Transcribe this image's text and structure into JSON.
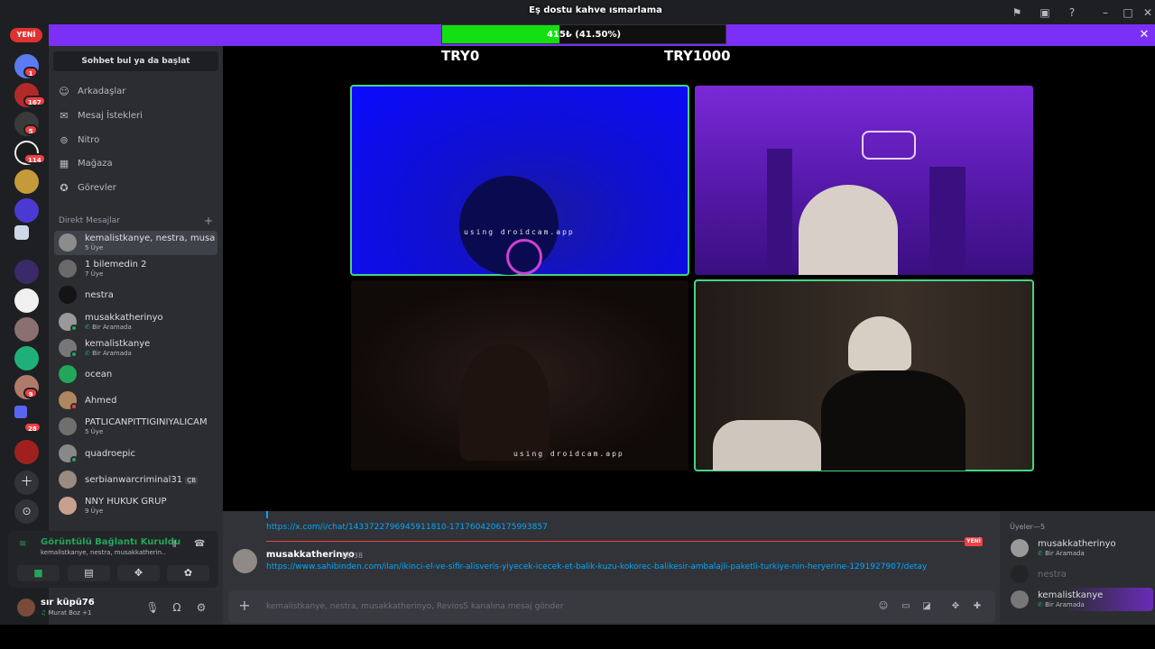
{
  "window": {
    "title": "Eş dostu kahve ısmarlama",
    "icons": [
      "inbox-icon",
      "screen-share-icon",
      "help-icon",
      "minimize-icon",
      "maximize-icon",
      "close-icon"
    ]
  },
  "donation": {
    "progress_text": "415₺ (41.50%)",
    "progress_fraction": 0.415,
    "min_label": "TRY0",
    "max_label": "TRY1000",
    "fill_color": "#12e012",
    "banner_color": "#7b2ff7"
  },
  "rail": {
    "new_pill": "YENİ",
    "badges": [
      "1",
      "167",
      "5",
      "114",
      "9",
      "28"
    ]
  },
  "sidebar": {
    "find_label": "Sohbet bul ya da başlat",
    "nav": [
      {
        "label": "Arkadaşlar",
        "icon": "friends-icon"
      },
      {
        "label": "Mesaj İstekleri",
        "icon": "mail-icon"
      },
      {
        "label": "Nitro",
        "icon": "nitro-icon"
      },
      {
        "label": "Mağaza",
        "icon": "shop-icon"
      },
      {
        "label": "Görevler",
        "icon": "quests-icon"
      }
    ],
    "dm_header": "Direkt Mesajlar",
    "dms": [
      {
        "name": "kemalistkanye, nestra, musa...",
        "sub": "5 Üye"
      },
      {
        "name": "1 bilemedin 2",
        "sub": "7 Üye"
      },
      {
        "name": "nestra",
        "sub": ""
      },
      {
        "name": "musakkatherinyo",
        "sub": "Bir Aramada"
      },
      {
        "name": "kemalistkanye",
        "sub": "Bir Aramada"
      },
      {
        "name": "ocean",
        "sub": ""
      },
      {
        "name": "Ahmed",
        "sub": ""
      },
      {
        "name": "PATLICANPITTIĞINIYALİCAM",
        "sub": "5 Üye"
      },
      {
        "name": "quadroepic",
        "sub": ""
      },
      {
        "name": "serbianwarcriminal31",
        "sub": ""
      },
      {
        "name": "NNY HUKUK GRUP",
        "sub": "9 Üye"
      }
    ],
    "dm9_tag": "ÇB"
  },
  "voice": {
    "title": "Görüntülü Bağlantı Kuruldu",
    "sub": "kemalistkanye, nestra, musakkatherin..."
  },
  "user": {
    "name": "sır küpü76",
    "status": "Murat Boz +1"
  },
  "stage": {
    "watermark": "using droidcam.app"
  },
  "chat": {
    "link1": "https://x.com/i/chat/1433722796945911810-1717604206175993857",
    "new_tag": "YENİ",
    "author": "musakkatherinyo",
    "time": "00:38",
    "link2": "https://www.sahibinden.com/ilan/ikinci-el-ve-sifir-alisveris-yiyecek-icecek-et-balik-kuzu-kokorec-balikesir-ambalajli-paketli-turkiye-nin-heryerine-1291927907/detay",
    "placeholder": "kemalistkanye, nestra, musakkatherinyo, ReviosS kanalına mesaj gönder"
  },
  "members": {
    "header": "Üyeler—5",
    "list": [
      {
        "name": "musakkatherinyo",
        "sub": "Bir Aramada"
      },
      {
        "name": "nestra",
        "sub": ""
      },
      {
        "name": "kemalistkanye",
        "sub": "Bir Aramada"
      }
    ]
  }
}
